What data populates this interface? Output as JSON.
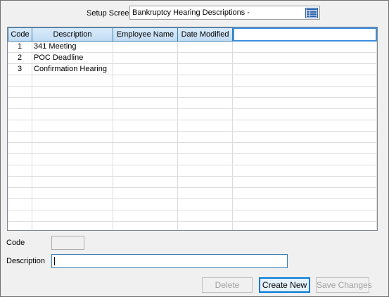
{
  "setup": {
    "label": "Setup Screen",
    "selected": "Bankruptcy Hearing Descriptions -",
    "list_icon": "table-list-icon"
  },
  "grid": {
    "columns": [
      {
        "label": "Code"
      },
      {
        "label": "Description"
      },
      {
        "label": "Employee Name"
      },
      {
        "label": "Date Modified"
      },
      {
        "label": ""
      }
    ],
    "rows": [
      {
        "code": "1",
        "description": "341 Meeting",
        "employee": "",
        "date": ""
      },
      {
        "code": "2",
        "description": "POC Deadline",
        "employee": "",
        "date": ""
      },
      {
        "code": "3",
        "description": "Confirmation Hearing",
        "employee": "",
        "date": ""
      }
    ]
  },
  "form": {
    "code_label": "Code",
    "code_value": "",
    "description_label": "Description",
    "description_value": ""
  },
  "buttons": {
    "delete": "Delete",
    "create_new": "Create New",
    "save_changes": "Save Changes"
  }
}
